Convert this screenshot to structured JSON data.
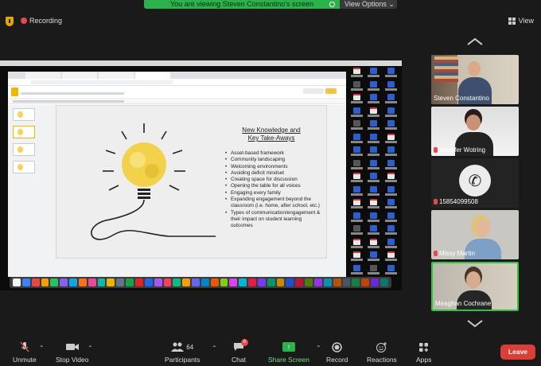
{
  "banner": {
    "message": "You are viewing Steven Constantino's screen",
    "options_label": "View Options"
  },
  "topbar": {
    "recording_label": "Recording",
    "view_label": "View"
  },
  "slide": {
    "title_line1": "New Knowledge and",
    "title_line2": "Key Take-Aways",
    "bullets": [
      "Asset-based framework",
      "Community landscaping",
      "Welcoming environments",
      "Avoiding deficit mindset",
      "Creating space for discussion",
      "Opening the table for all voices",
      "Engaging every family",
      "Expanding engagement beyond the classroom (i.e. home, after school, etc.)",
      "Types of communication/engagement & their impact on student learning outcomes"
    ]
  },
  "participants": [
    {
      "name": "Steven Constantino",
      "muted": false
    },
    {
      "name": "Jennifer Wotring",
      "muted": true
    },
    {
      "name": "15854099508",
      "muted": true
    },
    {
      "name": "Missy Martin",
      "muted": true
    },
    {
      "name": "Meaghan Cochrane",
      "muted": false,
      "active": true
    }
  ],
  "toolbar": {
    "unmute": "Unmute",
    "stop_video": "Stop Video",
    "participants": "Participants",
    "participants_count": "64",
    "chat": "Chat",
    "chat_badge": "6",
    "share_screen": "Share Screen",
    "record": "Record",
    "reactions": "Reactions",
    "apps": "Apps",
    "leave": "Leave"
  },
  "colors": {
    "accent_green": "#2bb24c",
    "leave_red": "#d93f36",
    "active_border": "#33c23b",
    "muted_red": "#e54a4a"
  }
}
